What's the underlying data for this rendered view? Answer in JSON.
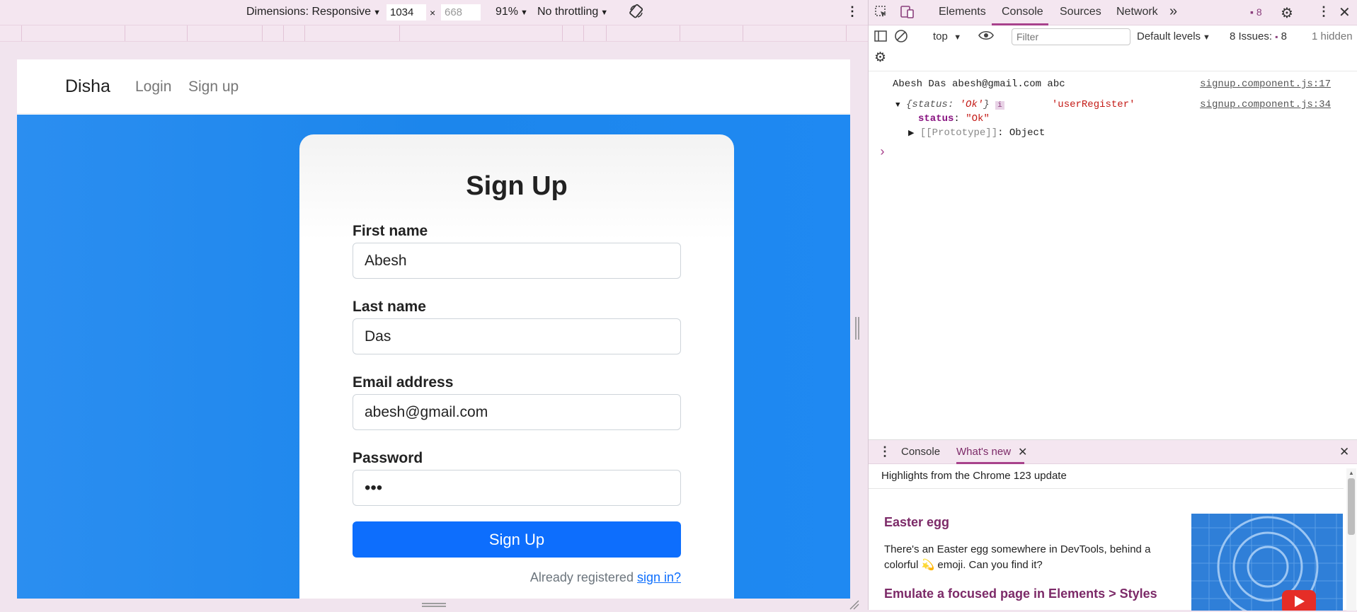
{
  "device_toolbar": {
    "dimensions_label": "Dimensions: Responsive",
    "width_value": "1034",
    "times": "×",
    "height_placeholder": "668",
    "zoom": "91%",
    "throttling": "No throttling",
    "rotate_icon": "rotate-icon",
    "more_icon": "more-vertical-icon"
  },
  "page": {
    "brand": "Disha",
    "nav": [
      "Login",
      "Sign up"
    ],
    "card_title": "Sign Up",
    "fields": [
      {
        "label": "First name",
        "value": "Abesh"
      },
      {
        "label": "Last name",
        "value": "Das"
      },
      {
        "label": "Email address",
        "value": "abesh@gmail.com"
      },
      {
        "label": "Password",
        "value": "•••"
      }
    ],
    "submit_label": "Sign Up",
    "already_text": "Already registered ",
    "signin_link": "sign in?"
  },
  "devtools": {
    "tabs": [
      "Elements",
      "Console",
      "Sources",
      "Network"
    ],
    "active_tab": "Console",
    "more_tabs": "»",
    "issues_badge_count": "8",
    "console_toolbar": {
      "context": "top",
      "filter_placeholder": "Filter",
      "levels": "Default levels",
      "issues_label": "8 Issues:",
      "issues_count": "8",
      "hidden": "1 hidden"
    },
    "logs": [
      {
        "text": "Abesh Das abesh@gmail.com abc",
        "source": "signup.component.js:17"
      },
      {
        "obj_prefix": "{status: ",
        "obj_val": "'Ok'",
        "obj_suffix": "}",
        "info": "i",
        "string": "'userRegister'",
        "source": "signup.component.js:34"
      },
      {
        "key": "status",
        "value": "\"Ok\""
      },
      {
        "proto": "[[Prototype]]",
        "proto_val": ": Object"
      }
    ],
    "prompt": "›",
    "drawer": {
      "tabs": [
        "Console",
        "What's new"
      ],
      "active": "What's new",
      "highlights": "Highlights from the Chrome 123 update",
      "items": [
        {
          "title": "Easter egg",
          "body": "There's an Easter egg somewhere in DevTools, behind a colorful 💫 emoji. Can you find it?"
        },
        {
          "title": "Emulate a focused page in Elements > Styles"
        }
      ]
    }
  },
  "colors": {
    "primary": "#0d6efd",
    "hero": "#1c86ec",
    "devtools_accent": "#a8428c"
  }
}
